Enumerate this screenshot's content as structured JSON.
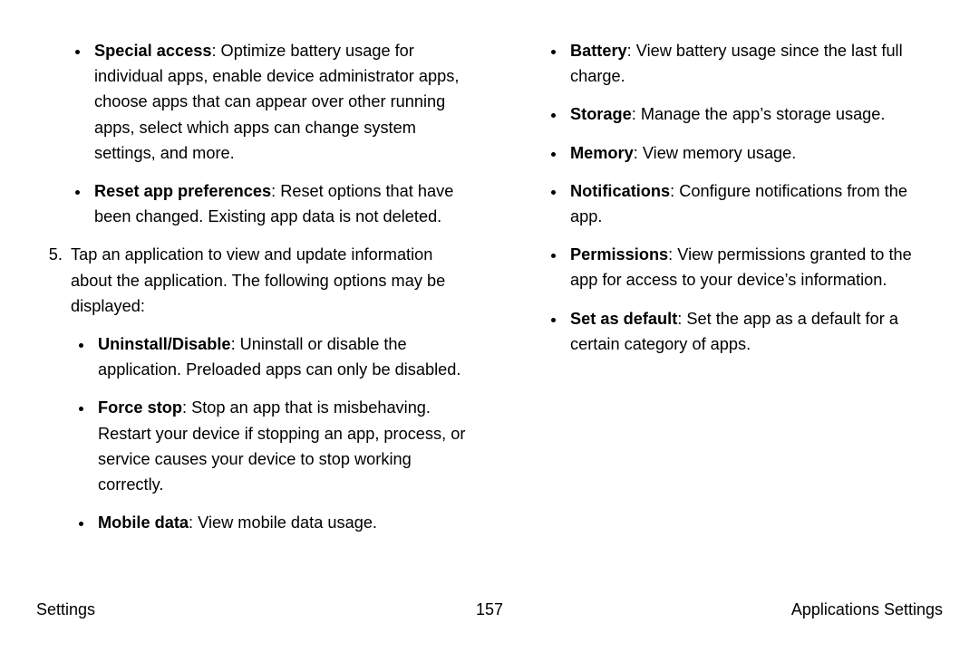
{
  "left": {
    "pre_bullets": [
      {
        "label": "Special access",
        "desc": ": Optimize battery usage for individual apps, enable device administrator apps, choose apps that can appear over other running apps, select which apps can change system settings, and more."
      },
      {
        "label": "Reset app preferences",
        "desc": ": Reset options that have been changed. Existing app data is not deleted."
      }
    ],
    "step_num": "5.",
    "step_text": "Tap an application to view and update information about the application. The following options may be displayed:",
    "step_bullets": [
      {
        "label": "Uninstall/Disable",
        "desc": ": Uninstall or disable the application. Preloaded apps can only be disabled."
      },
      {
        "label": "Force stop",
        "desc": ": Stop an app that is misbehaving. Restart your device if stopping an app, process, or service causes your device to stop working correctly."
      },
      {
        "label": "Mobile data",
        "desc": ": View mobile data usage."
      }
    ]
  },
  "right": {
    "bullets": [
      {
        "label": "Battery",
        "desc": ": View battery usage since the last full charge."
      },
      {
        "label": "Storage",
        "desc": ": Manage the app’s storage usage."
      },
      {
        "label": "Memory",
        "desc": ": View memory usage."
      },
      {
        "label": "Notifications",
        "desc": ": Configure notifications from the app."
      },
      {
        "label": "Permissions",
        "desc": ": View permissions granted to the app for access to your device’s information."
      },
      {
        "label": "Set as default",
        "desc": ": Set the app as a default for a certain category of apps."
      }
    ]
  },
  "footer": {
    "left": "Settings",
    "center": "157",
    "right": "Applications Settings"
  }
}
